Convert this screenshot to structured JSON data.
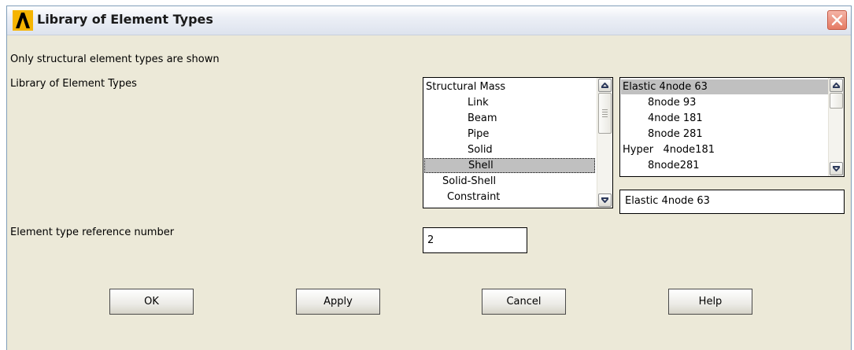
{
  "window": {
    "title": "Library of Element Types"
  },
  "notice": "Only structural element types are shown",
  "library_label": "Library of Element Types",
  "category_list": {
    "items": [
      "Structural Mass",
      "Link",
      "Beam",
      "Pipe",
      "Solid",
      "Shell",
      "Solid-Shell",
      "Constraint"
    ],
    "selected": "Shell"
  },
  "element_list": {
    "items": [
      "Elastic 4node 63",
      "8node 93",
      "4node 181",
      "8node 281",
      "Hyper   4node181",
      "8node281"
    ],
    "selected": "Elastic 4node 63"
  },
  "selection_field": {
    "value": "Elastic 4node 63"
  },
  "ref_number": {
    "label": "Element type reference number",
    "value": "2"
  },
  "buttons": {
    "ok": "OK",
    "apply": "Apply",
    "cancel": "Cancel",
    "help": "Help"
  },
  "colors": {
    "selected_bg": "#c0c0c0",
    "dialog_bg": "#ece9d8",
    "close_button": "#e57a63"
  },
  "icons": [
    "ansys-logo-icon",
    "close-icon",
    "arrow-up-icon",
    "arrow-down-icon"
  ]
}
